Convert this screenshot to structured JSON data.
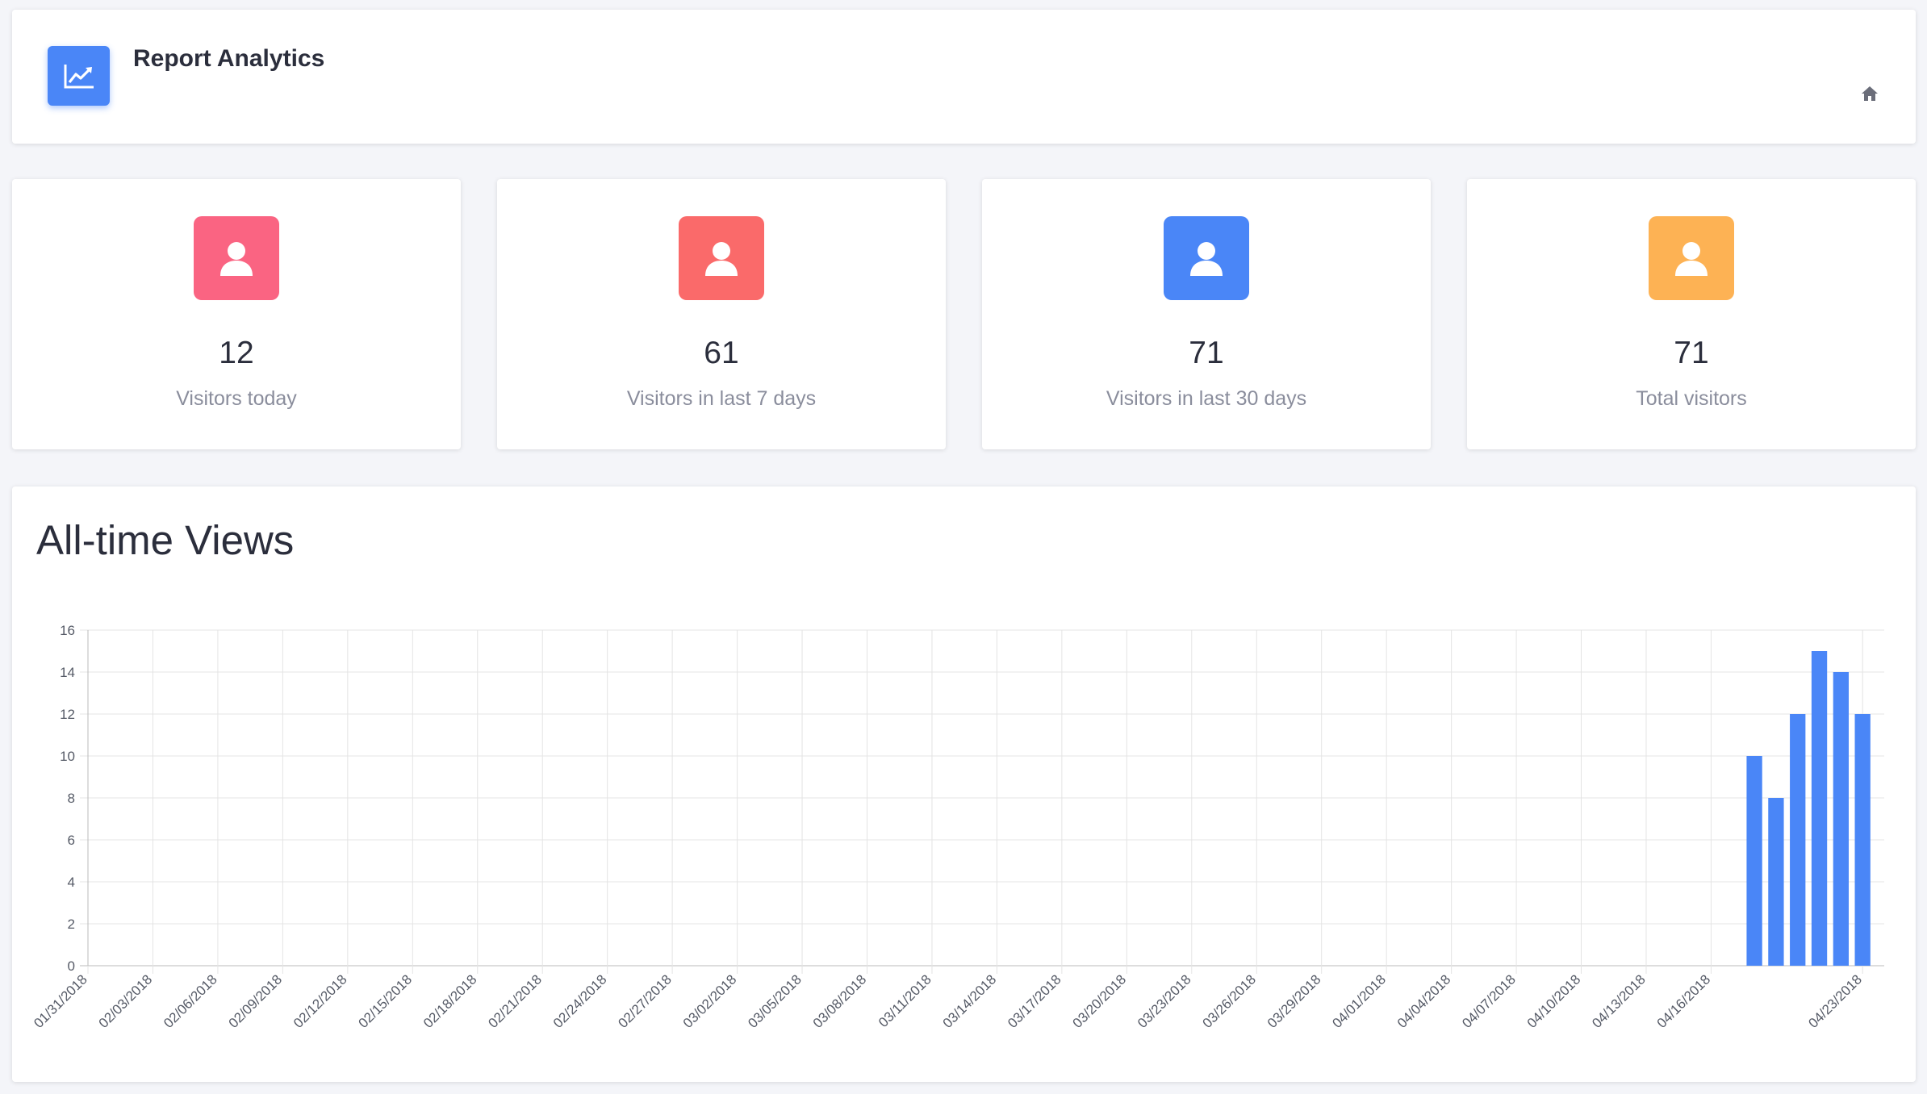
{
  "header": {
    "title": "Report Analytics",
    "icon": "line-chart-icon",
    "home_icon": "home-icon",
    "accent": "#4a86f7"
  },
  "stats": [
    {
      "value": "12",
      "label": "Visitors today",
      "color": "#fa6482",
      "icon": "user-icon"
    },
    {
      "value": "61",
      "label": "Visitors in last 7 days",
      "color": "#fa6a6a",
      "icon": "user-icon"
    },
    {
      "value": "71",
      "label": "Visitors in last 30 days",
      "color": "#4a86f7",
      "icon": "user-icon"
    },
    {
      "value": "71",
      "label": "Total visitors",
      "color": "#fdb254",
      "icon": "user-icon"
    }
  ],
  "chart": {
    "title": "All-time Views"
  },
  "chart_data": {
    "type": "bar",
    "title": "All-time Views",
    "xlabel": "",
    "ylabel": "",
    "ylim": [
      0,
      16
    ],
    "yticks": [
      0,
      2,
      4,
      6,
      8,
      10,
      12,
      14,
      16
    ],
    "grid": true,
    "color": "#4a86f7",
    "x_tick_labels": [
      "01/31/2018",
      "02/03/2018",
      "02/06/2018",
      "02/09/2018",
      "02/12/2018",
      "02/15/2018",
      "02/18/2018",
      "02/21/2018",
      "02/24/2018",
      "02/27/2018",
      "03/02/2018",
      "03/05/2018",
      "03/08/2018",
      "03/11/2018",
      "03/14/2018",
      "03/17/2018",
      "03/20/2018",
      "03/23/2018",
      "03/26/2018",
      "03/29/2018",
      "04/01/2018",
      "04/04/2018",
      "04/07/2018",
      "04/10/2018",
      "04/13/2018",
      "04/16/2018",
      "04/23/2018"
    ],
    "x": [
      "04/18/2018",
      "04/19/2018",
      "04/20/2018",
      "04/21/2018",
      "04/22/2018",
      "04/23/2018"
    ],
    "values": [
      10,
      8,
      12,
      15,
      14,
      12
    ]
  }
}
